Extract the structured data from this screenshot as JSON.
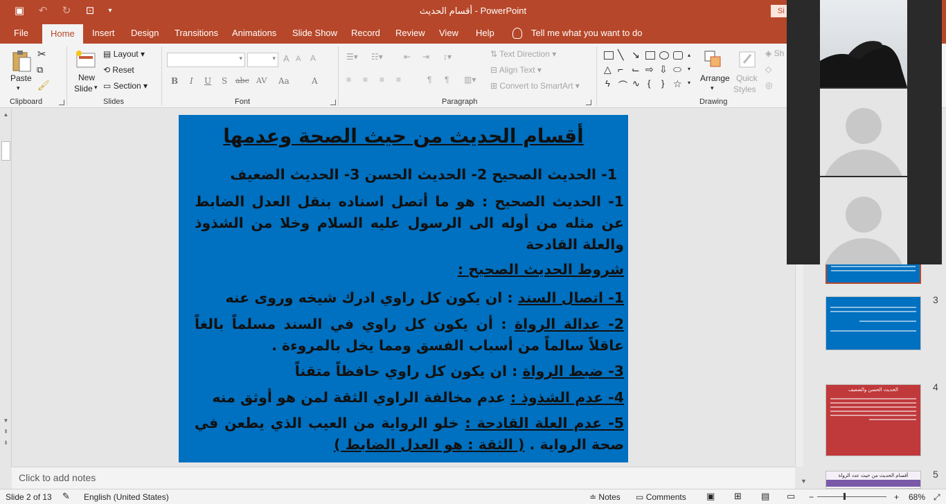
{
  "app": {
    "document_title": "أقسام الحديث",
    "app_name": "PowerPoint",
    "sign_in": "Si"
  },
  "tabs": [
    "File",
    "Home",
    "Insert",
    "Design",
    "Transitions",
    "Animations",
    "Slide Show",
    "Record",
    "Review",
    "View",
    "Help"
  ],
  "active_tab": "Home",
  "tell_me": "Tell me what you want to do",
  "ribbon": {
    "clipboard": {
      "paste": "Paste",
      "label": "Clipboard"
    },
    "slides": {
      "new_slide_1": "New",
      "new_slide_2": "Slide",
      "layout": "Layout",
      "reset": "Reset",
      "section": "Section",
      "label": "Slides"
    },
    "font": {
      "label": "Font",
      "buttons": [
        "B",
        "I",
        "U",
        "S",
        "abc",
        "AV",
        "Aa",
        "A"
      ]
    },
    "paragraph": {
      "label": "Paragraph",
      "text_direction": "Text Direction",
      "align_text": "Align Text",
      "convert_smartart": "Convert to SmartArt"
    },
    "drawing": {
      "label": "Drawing",
      "arrange": "Arrange",
      "quick_styles_1": "Quick",
      "quick_styles_2": "Styles",
      "shape_fill": "Sh"
    }
  },
  "slide": {
    "title": "أقسام الحديث من حيث الصحة وعدمها",
    "divisions": "1- الحديث الصحيح 2- الحديث الحسن 3- الحديث الضعيف",
    "definition": "1- الحديث الصحيح : هو ما أتصل اسناده بنقل العدل الضابط عن مثله من أوله الى الرسول عليه السلام وخلا من الشذوذ والعلة القادحة",
    "conditions_heading": "شروط الحديث الصحيح :",
    "c1_label": "1- اتصال السند",
    "c1_text": ": ان يكون كل راوي ادرك شيخه وروى عنه",
    "c2_label": "2- عدالة الرواة",
    "c2_text": ": أن يكون كل راوي في السند مسلماً بالغاً عاقلاً سالماً من أسباب الفسق ومما يخل بالمروءة .",
    "c3_label": "3- ضبط الرواة",
    "c3_text": ": ان يكون كل راوي حافظاً متقناً",
    "c4_label": "4- عدم الشذوذ :",
    "c4_text": "عدم مخالفة الراوي الثقة لمن هو أوثق منه",
    "c5_label": "5- عدم العلة القادحة :",
    "c5_text": "خلو الرواية من العيب الذي يطعن في صحة الرواية .",
    "c5_note": "( الثقة : هو العدل الضابط )"
  },
  "notes_placeholder": "Click to add notes",
  "thumbnails": [
    {
      "number": "3",
      "theme": "blue"
    },
    {
      "number": "4",
      "theme": "red",
      "title": "الحديث الحسن والضعيف"
    },
    {
      "number": "5",
      "theme": "purple",
      "title": "أقسام الحديث من حيث عدد الرواة"
    }
  ],
  "status": {
    "slide_counter": "Slide 2 of 13",
    "language": "English (United States)",
    "notes": "Notes",
    "comments": "Comments",
    "zoom": "68%"
  },
  "colors": {
    "ribbon_accent": "#b7472a",
    "slide_bg": "#0070c0"
  }
}
